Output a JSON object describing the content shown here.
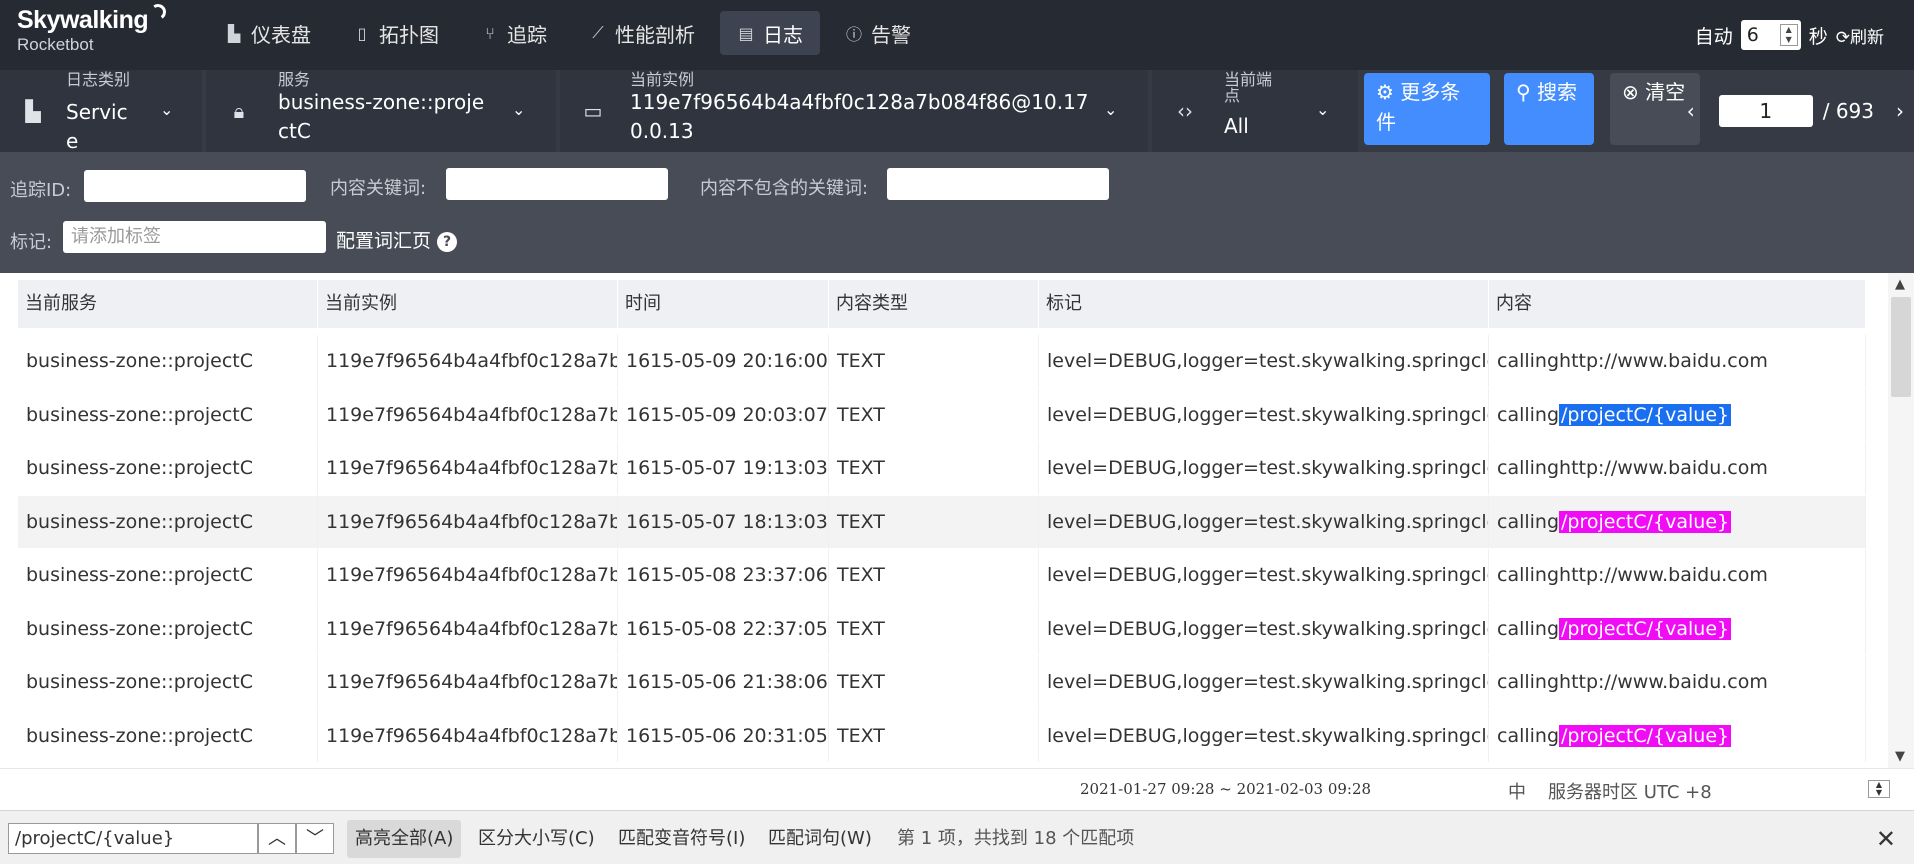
{
  "app": {
    "logo_line1": "Skywalking",
    "logo_line2": "Rocketbot"
  },
  "nav": {
    "items": [
      {
        "label": "仪表盘",
        "icon": "dashboard-icon"
      },
      {
        "label": "拓扑图",
        "icon": "topology-icon"
      },
      {
        "label": "追踪",
        "icon": "trace-icon"
      },
      {
        "label": "性能剖析",
        "icon": "profile-icon"
      },
      {
        "label": "日志",
        "icon": "log-icon",
        "active": true
      },
      {
        "label": "告警",
        "icon": "alarm-icon"
      }
    ],
    "auto_label": "自动",
    "interval_value": "6",
    "seconds_label": "秒",
    "refresh_label": "刷新"
  },
  "filters": {
    "log_type": {
      "label": "日志类别",
      "value": "Service"
    },
    "service": {
      "label": "服务",
      "value": "business-zone::projectC"
    },
    "instance": {
      "label": "当前实例",
      "value": "119e7f96564b4a4fbf0c128a7b084f86@10.170.0.13"
    },
    "endpoint": {
      "label": "当前端点",
      "value": "All"
    },
    "more_button": "更多条件",
    "search_button": "搜索",
    "clear_button": "清空",
    "page_current": "1",
    "page_total": "/ 693"
  },
  "search": {
    "trace_id_label": "追踪ID:",
    "keyword_label": "内容关键词:",
    "exclude_label": "内容不包含的关键词:",
    "tag_label": "标记:",
    "tag_placeholder": "请添加标签",
    "vocab_link": "配置词汇页"
  },
  "table": {
    "columns": [
      "当前服务",
      "当前实例",
      "时间",
      "内容类型",
      "标记",
      "内容"
    ],
    "rows": [
      {
        "service": "business-zone::projectC",
        "instance": "119e7f96564b4a4fbf0c128a7b...",
        "time": "1615-05-09 20:16:00",
        "type": "TEXT",
        "tags": "level=DEBUG,logger=test.skywalking.springclou...",
        "content_prefix": "calling",
        "content_rest": "http://www.baidu.com",
        "highlight": "none"
      },
      {
        "service": "business-zone::projectC",
        "instance": "119e7f96564b4a4fbf0c128a7b...",
        "time": "1615-05-09 20:03:07",
        "type": "TEXT",
        "tags": "level=DEBUG,logger=test.skywalking.springclou...",
        "content_prefix": "calling",
        "content_rest": "/projectC/{value}",
        "highlight": "current"
      },
      {
        "service": "business-zone::projectC",
        "instance": "119e7f96564b4a4fbf0c128a7b...",
        "time": "1615-05-07 19:13:03",
        "type": "TEXT",
        "tags": "level=DEBUG,logger=test.skywalking.springclou...",
        "content_prefix": "calling",
        "content_rest": "http://www.baidu.com",
        "highlight": "none"
      },
      {
        "service": "business-zone::projectC",
        "instance": "119e7f96564b4a4fbf0c128a7b...",
        "time": "1615-05-07 18:13:03",
        "type": "TEXT",
        "tags": "level=DEBUG,logger=test.skywalking.springclou...",
        "content_prefix": "calling",
        "content_rest": "/projectC/{value}",
        "highlight": "match"
      },
      {
        "service": "business-zone::projectC",
        "instance": "119e7f96564b4a4fbf0c128a7b...",
        "time": "1615-05-08 23:37:06",
        "type": "TEXT",
        "tags": "level=DEBUG,logger=test.skywalking.springclou...",
        "content_prefix": "calling",
        "content_rest": "http://www.baidu.com",
        "highlight": "none"
      },
      {
        "service": "business-zone::projectC",
        "instance": "119e7f96564b4a4fbf0c128a7b...",
        "time": "1615-05-08 22:37:05",
        "type": "TEXT",
        "tags": "level=DEBUG,logger=test.skywalking.springclou...",
        "content_prefix": "calling",
        "content_rest": "/projectC/{value}",
        "highlight": "match"
      },
      {
        "service": "business-zone::projectC",
        "instance": "119e7f96564b4a4fbf0c128a7b...",
        "time": "1615-05-06 21:38:06",
        "type": "TEXT",
        "tags": "level=DEBUG,logger=test.skywalking.springclou...",
        "content_prefix": "calling",
        "content_rest": "http://www.baidu.com",
        "highlight": "none"
      },
      {
        "service": "business-zone::projectC",
        "instance": "119e7f96564b4a4fbf0c128a7b...",
        "time": "1615-05-06 20:31:05",
        "type": "TEXT",
        "tags": "level=DEBUG,logger=test.skywalking.springclou...",
        "content_prefix": "calling",
        "content_rest": "/projectC/{value}",
        "highlight": "match"
      }
    ]
  },
  "footer": {
    "time_range": "2021-01-27 09:28 ~ 2021-02-03 09:28",
    "language": "中",
    "timezone": "服务器时区 UTC +8"
  },
  "findbar": {
    "query": "/projectC/{value}",
    "highlight_all": "高亮全部(A)",
    "match_case": "区分大小写(C)",
    "match_diacritics": "匹配变音符号(I)",
    "whole_words": "匹配词句(W)",
    "status": "第 1 项，共找到 18 个匹配项"
  },
  "colors": {
    "nav_bg": "#262a33",
    "filter_bg": "#353a45",
    "search_bg": "#474c57",
    "accent_blue": "#448dfe",
    "highlight_current": "#1a6ff0",
    "highlight_match": "#f00df6"
  }
}
